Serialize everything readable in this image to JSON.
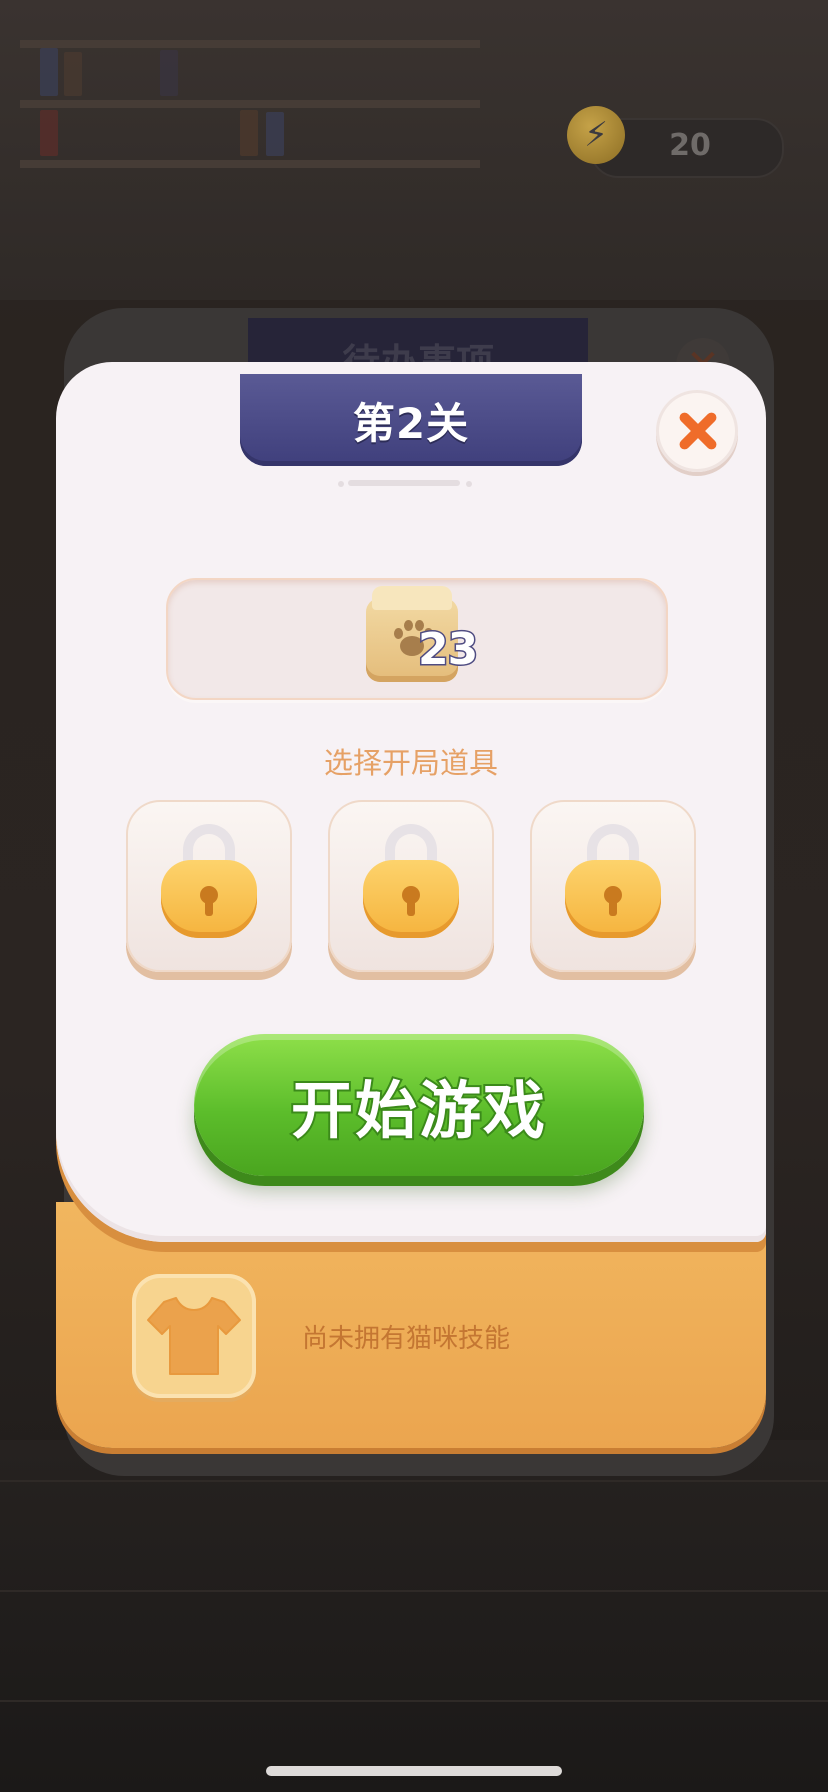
{
  "hud": {
    "energy_icon": "lightning-icon",
    "energy_value": "20"
  },
  "background_panel": {
    "title": "待办事项"
  },
  "modal": {
    "title": "第2关",
    "close_icon": "close-icon",
    "goal": {
      "icon": "paw-box-icon",
      "count": "23"
    },
    "props_label": "选择开局道具",
    "prop_slots": [
      {
        "state": "locked",
        "icon": "lock-icon"
      },
      {
        "state": "locked",
        "icon": "lock-icon"
      },
      {
        "state": "locked",
        "icon": "lock-icon"
      }
    ],
    "start_button": "开始游戏",
    "skill": {
      "icon": "shirt-icon",
      "text": "尚未拥有猫咪技能"
    }
  },
  "colors": {
    "title_tab": "#4a4a88",
    "start_button": "#5cbd2b",
    "close_x": "#ef6c2a",
    "bottom_panel": "#eeaa53",
    "lock": "#f8c24e"
  }
}
